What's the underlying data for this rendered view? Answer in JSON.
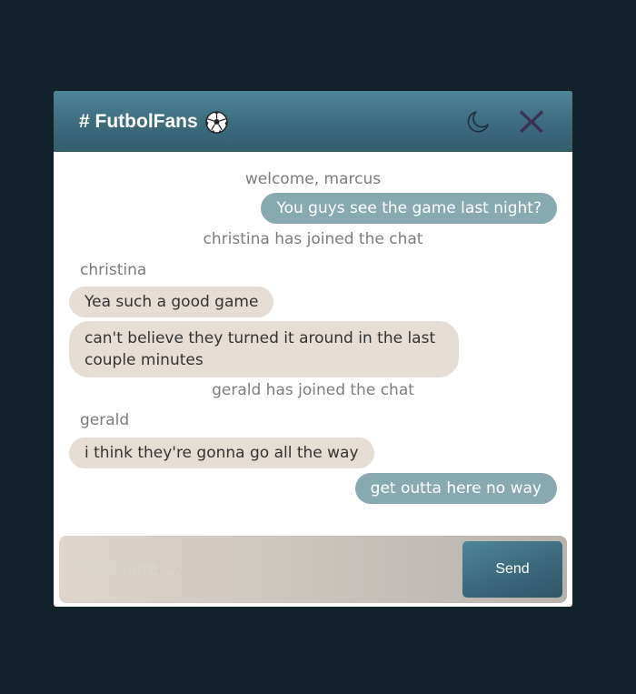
{
  "header": {
    "title": "# FutbolFans",
    "title_icon": "soccer-ball-icon",
    "theme_toggle_icon": "moon-icon",
    "close_icon": "close-x-icon",
    "colors": {
      "header_gradient_top": "#4f8599",
      "header_gradient_bottom": "#335d6d",
      "close_icon": "#3a3350"
    }
  },
  "messages": [
    {
      "type": "system",
      "text": "welcome, marcus"
    },
    {
      "type": "outgoing",
      "text": "You guys see the game last night?"
    },
    {
      "type": "system",
      "text": "christina has joined the chat"
    },
    {
      "type": "sender",
      "text": "christina"
    },
    {
      "type": "incoming",
      "text": "Yea such a good game"
    },
    {
      "type": "incoming",
      "text": "can't believe they turned it around in the last couple minutes"
    },
    {
      "type": "system",
      "text": "gerald has joined the chat"
    },
    {
      "type": "sender",
      "text": "gerald"
    },
    {
      "type": "incoming",
      "text": "i think they're gonna go all the way"
    },
    {
      "type": "outgoing",
      "text": "get outta here no way"
    }
  ],
  "composer": {
    "placeholder": "Type here ...",
    "value": "",
    "send_label": "Send"
  },
  "colors": {
    "page_background": "#13212b",
    "outgoing_bubble": "#86aaaf",
    "incoming_bubble": "#e6ddd4",
    "system_text": "#7d7d7d"
  }
}
